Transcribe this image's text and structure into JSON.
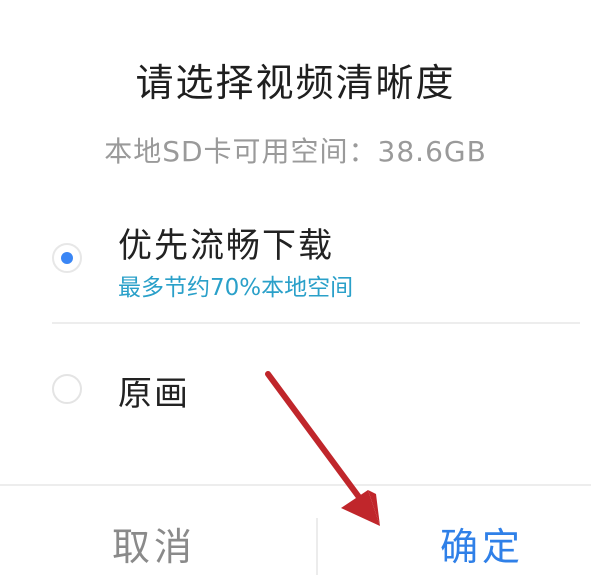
{
  "dialog": {
    "title": "请选择视频清晰度",
    "storage_info": "本地SD卡可用空间：38.6GB",
    "options": [
      {
        "label": "优先流畅下载",
        "description": "最多节约70%本地空间",
        "selected": true
      },
      {
        "label": "原画",
        "selected": false
      }
    ],
    "buttons": {
      "cancel": "取消",
      "confirm": "确定"
    }
  },
  "colors": {
    "accent": "#3a86f5",
    "description": "#2aa0c9",
    "annotation_arrow": "#c0262b"
  }
}
